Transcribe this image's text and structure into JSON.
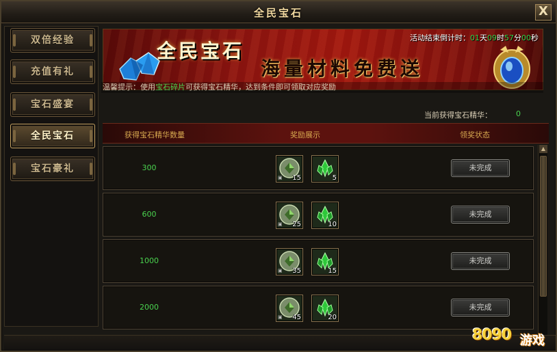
{
  "window": {
    "title": "全民宝石",
    "close_label": "X"
  },
  "sidebar": {
    "items": [
      {
        "label": "双倍经验",
        "active": false
      },
      {
        "label": "充值有礼",
        "active": false
      },
      {
        "label": "宝石盛宴",
        "active": false
      },
      {
        "label": "全民宝石",
        "active": true
      },
      {
        "label": "宝石豪礼",
        "active": false
      }
    ]
  },
  "banner": {
    "title": "全民宝石",
    "slogan": "海量材料免费送",
    "countdown_label": "活动结束倒计时：",
    "days": "01",
    "days_unit": "天",
    "hours": "09",
    "hours_unit": "时",
    "minutes": "57",
    "minutes_unit": "分",
    "seconds": "00",
    "seconds_unit": "秒"
  },
  "tip": {
    "prefix": "温馨提示：使用",
    "highlight": "宝石碎片",
    "suffix": "可获得宝石精华，达到条件即可领取对应奖励"
  },
  "essence": {
    "label": "当前获得宝石精华：",
    "value": "0"
  },
  "table": {
    "headers": [
      "获得宝石精华数量",
      "奖励展示",
      "领奖状态"
    ],
    "rows": [
      {
        "value": "300",
        "rewards": [
          {
            "icon": "gem-shard-icon",
            "count": "15"
          },
          {
            "icon": "green-crystal-icon",
            "count": "5"
          }
        ],
        "status": "未完成"
      },
      {
        "value": "600",
        "rewards": [
          {
            "icon": "gem-shard-icon",
            "count": "25"
          },
          {
            "icon": "green-crystal-icon",
            "count": "10"
          }
        ],
        "status": "未完成"
      },
      {
        "value": "1000",
        "rewards": [
          {
            "icon": "gem-shard-icon",
            "count": "35"
          },
          {
            "icon": "green-crystal-icon",
            "count": "15"
          }
        ],
        "status": "未完成"
      },
      {
        "value": "2000",
        "rewards": [
          {
            "icon": "gem-shard-icon",
            "count": "45"
          },
          {
            "icon": "green-crystal-icon",
            "count": "20"
          }
        ],
        "status": "未完成"
      }
    ]
  },
  "watermark": {
    "number": "8090",
    "text": "游戏"
  },
  "colors": {
    "highlight_green": "#4ad34f",
    "header_gold": "#d7a94f",
    "banner_red": "#8e1410"
  }
}
